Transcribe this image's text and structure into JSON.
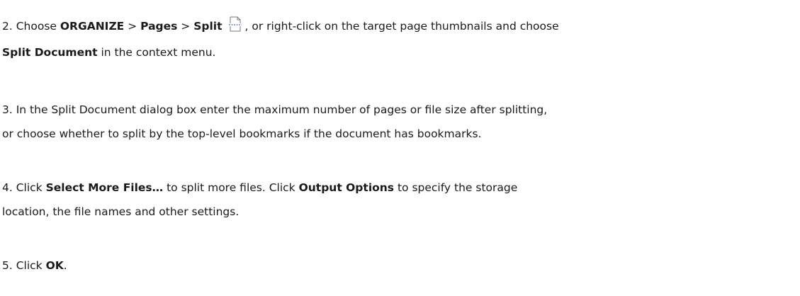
{
  "step2": {
    "lead": "2. Choose ",
    "menu1": "ORGANIZE",
    "sep1": " > ",
    "menu2": "Pages",
    "sep2": " > ",
    "menu3": "Split",
    "after_icon": ", or right-click on the target page thumbnails and choose",
    "menu_item": "Split Document",
    "tail": " in the context menu.",
    "icon": "split-page-icon"
  },
  "step3": {
    "line1": "3. In the Split Document dialog box enter the maximum number of pages or file size after splitting,",
    "line2": "or choose whether to split by the top-level bookmarks if the document has bookmarks."
  },
  "step4": {
    "lead": "4. Click ",
    "btn1": "Select More Files…",
    "mid": " to split more files. Click ",
    "btn2": "Output Options",
    "tail1": " to specify the storage",
    "line2": "location, the file names and other settings."
  },
  "step5": {
    "lead": "5. Click ",
    "btn": "OK",
    "tail": "."
  }
}
